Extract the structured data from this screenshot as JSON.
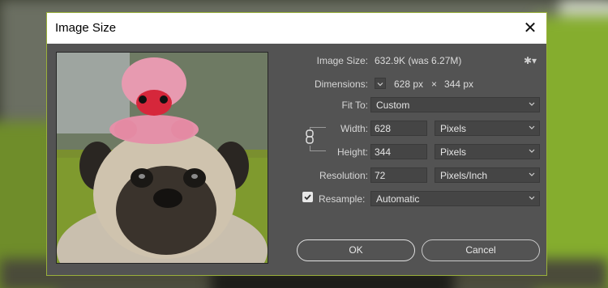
{
  "dialog": {
    "title": "Image Size",
    "image_size_label": "Image Size:",
    "image_size_value": "632.9K (was 6.27M)",
    "dimensions_label": "Dimensions:",
    "dim_width": "628 px",
    "dim_x": "×",
    "dim_height": "344 px",
    "fit_to_label": "Fit To:",
    "fit_to_value": "Custom",
    "width_label": "Width:",
    "width_value": "628",
    "width_unit": "Pixels",
    "height_label": "Height:",
    "height_value": "344",
    "height_unit": "Pixels",
    "resolution_label": "Resolution:",
    "resolution_value": "72",
    "resolution_unit": "Pixels/Inch",
    "resample_label": "Resample:",
    "resample_checked": true,
    "resample_value": "Automatic",
    "ok_label": "OK",
    "cancel_label": "Cancel"
  },
  "icons": {
    "close": "close-icon",
    "settings": "gear-icon",
    "link": "chain-link-icon",
    "check": "checkmark-icon",
    "dropdown": "chevron-down-icon"
  },
  "colors": {
    "dialog_bg": "#535353",
    "field_bg": "#454545",
    "accent_border": "#9ab03a"
  }
}
